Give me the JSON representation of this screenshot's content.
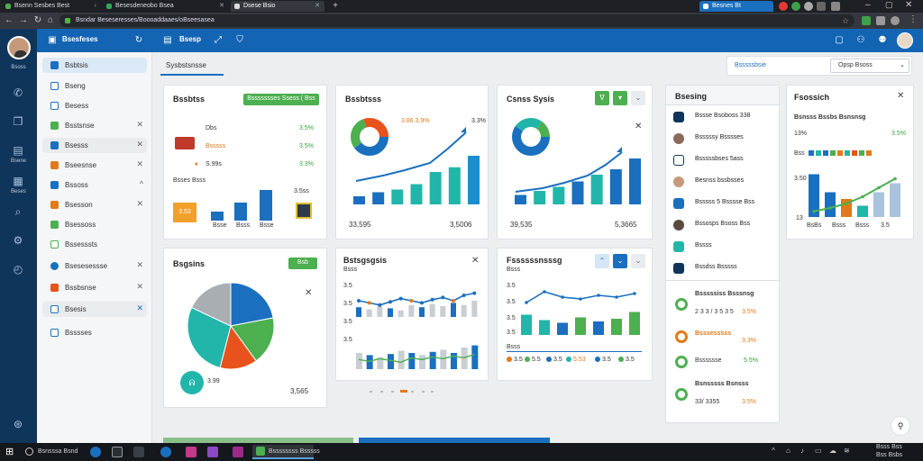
{
  "browser": {
    "tabs": [
      {
        "label": "Bsenn Sesbes Best"
      },
      {
        "label": "Besesdeneobo Bsea"
      },
      {
        "label": "Dsese Bsio"
      },
      {
        "label": "Bteus Baesses"
      }
    ],
    "url": "Bsndar Beseseresses/Boooaddaaes/oBseesasea",
    "tray_label": "Besnes Bt"
  },
  "rail": {
    "labels": [
      "Bsoss",
      "Bsene",
      "Beses"
    ]
  },
  "header": {
    "app_title": "Bsesfeses",
    "section_label": "Bsesp"
  },
  "sidebar": {
    "items": [
      {
        "label": "Bsbtsis"
      },
      {
        "label": "Bseng"
      },
      {
        "label": "Besess"
      },
      {
        "label": "Bsstsnse"
      },
      {
        "label": "Bsesss"
      },
      {
        "label": "Bseesnse"
      },
      {
        "label": "Bssoss"
      },
      {
        "label": "Bsesson"
      },
      {
        "label": "Bsessoss"
      },
      {
        "label": "Bssesssts"
      },
      {
        "label": "Bsesesessse"
      },
      {
        "label": "Bssbsnse"
      },
      {
        "label": "Bsesis"
      },
      {
        "label": "Bsssses"
      }
    ]
  },
  "toolbar": {
    "tab_label": "Sysbstsnsse",
    "date_label": "Bsssssbsie",
    "select_value": "Opsp Bsoss"
  },
  "card1": {
    "title": "Bssbtss",
    "button": "Bssssssses Ssess (  Bss",
    "rows": [
      {
        "label": "Dbs",
        "value": "3.5%"
      },
      {
        "label": "Bsssss",
        "value": "3.5%"
      },
      {
        "label": "S.99s",
        "value": "3.3%"
      }
    ],
    "sub": "Bsses Bsss",
    "value": "3.5ss",
    "tag": "3.53",
    "xlabels": [
      "Bsse",
      "Bsss",
      "Bsse"
    ]
  },
  "card2": {
    "title": "Bssbtsss",
    "pct": "3.86 3.9%",
    "pct2": "3.3%",
    "left": "33,595",
    "right": "3,5006",
    "chart_data": {
      "type": "bar",
      "categories": [
        "1",
        "2",
        "3",
        "4",
        "5",
        "6",
        "7"
      ],
      "values": [
        12,
        18,
        22,
        30,
        48,
        55,
        72
      ],
      "ylim": [
        0,
        80
      ]
    }
  },
  "card3": {
    "title": "Csnss Sysis",
    "left": "39,535",
    "right": "5,3665",
    "chart_data": {
      "type": "bar",
      "categories": [
        "1",
        "2",
        "3",
        "4",
        "5",
        "6",
        "7"
      ],
      "values": [
        14,
        20,
        26,
        34,
        44,
        52,
        68
      ],
      "ylim": [
        0,
        80
      ]
    }
  },
  "card4": {
    "title": "Bsesing",
    "items": [
      "Bssse Bsoboss 338",
      "Bsssssy Bsssses",
      "Bsssssbses 5ass",
      "Besnss bssbsses",
      "Bsssss 5 Bsssse Bss",
      "Bssosps Bsoss Bss",
      "Bssss",
      "Bssdss Bsssss"
    ],
    "groups": [
      {
        "title": "Bsssssiss Bsssnsg",
        "line": "2 3 3 / 3 5 3 5",
        "value": "3.5%"
      },
      {
        "title": "Bsssesssss",
        "line": "",
        "value": "3.3%"
      },
      {
        "title": "Bsssssse",
        "line": "",
        "value": "5.5%"
      },
      {
        "title": "Bsnsssss Bsnsss",
        "line": "33/ 3355",
        "value": "3.5%"
      }
    ]
  },
  "card5": {
    "title": "Fsossich",
    "subtitle": "Bsnsss Bssbs Bsnsnsg",
    "pct1": "13%",
    "pct2": "3.5%",
    "sub": "Bss",
    "tick_top": "3.50",
    "tick_bottom": "13",
    "xlabels": [
      "BsBs",
      "Bsss",
      "Bsss",
      "3.5"
    ],
    "chart_data": {
      "type": "bar",
      "categories": [
        "a",
        "b",
        "c",
        "d",
        "e",
        "f"
      ],
      "values": [
        38,
        22,
        16,
        10,
        22,
        30
      ],
      "line": [
        5,
        8,
        12,
        18,
        26,
        34
      ],
      "ylim": [
        0,
        40
      ]
    }
  },
  "card6": {
    "title": "Bsgsins",
    "button": "Bsb",
    "legend": "3.99",
    "total": "3,565",
    "chart_data": {
      "type": "pie",
      "labels": [
        "A",
        "B",
        "C",
        "D",
        "E"
      ],
      "values": [
        22,
        18,
        14,
        28,
        18
      ],
      "colors": [
        "#1a6fbf",
        "#4caf50",
        "#e8521c",
        "#22b5aa",
        "#a9aeb3"
      ]
    }
  },
  "card7": {
    "title": "Bstsgsgsis",
    "subtitle": "Bsss",
    "ticks": [
      "3.5",
      "3.5",
      "3.5",
      "3.5"
    ],
    "chart_data": {
      "type": "bar",
      "categories": [
        "1",
        "2",
        "3",
        "4",
        "5",
        "6",
        "7",
        "8",
        "9",
        "10",
        "11",
        "12"
      ],
      "values": [
        30,
        26,
        22,
        28,
        34,
        30,
        26,
        32,
        36,
        30,
        40,
        44
      ],
      "values2": [
        18,
        14,
        20,
        16,
        12,
        22,
        18,
        24,
        20,
        26,
        22,
        30
      ],
      "ylim": [
        0,
        50
      ]
    }
  },
  "card8": {
    "title": "Fssssssnsssg",
    "subtitle": "Bsss",
    "ticks": [
      "3.5",
      "3.5",
      "3.5",
      "3.5"
    ],
    "caption": "Bsss",
    "legend": [
      "3.5",
      "5.5",
      "3.5",
      "5.53",
      "3.5",
      "3.5"
    ],
    "chart_data": {
      "type": "bar",
      "categories": [
        "1",
        "2",
        "3",
        "4",
        "5",
        "6",
        "7"
      ],
      "values": [
        30,
        22,
        18,
        26,
        20,
        24,
        34
      ],
      "ylim": [
        0,
        40
      ]
    }
  },
  "taskbar": {
    "search": "Bsnsssa Bsnd",
    "app": "Bssssssss Bsssss",
    "time": "Bsss Bss",
    "date": "Bss Bsbs"
  }
}
